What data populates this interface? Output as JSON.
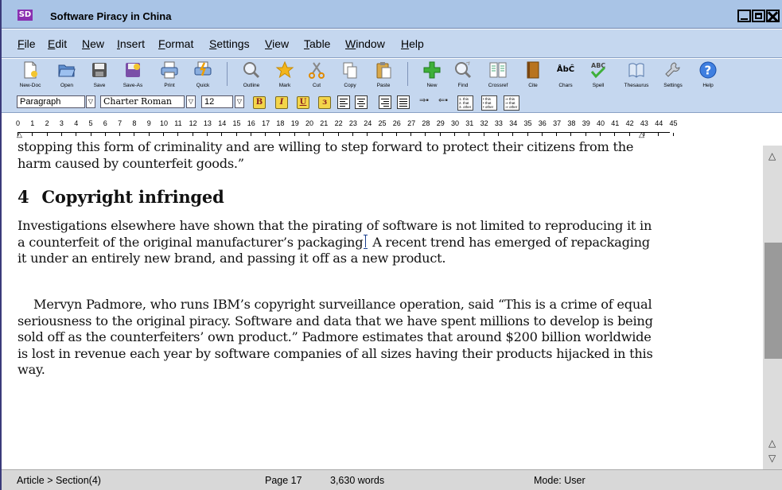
{
  "window": {
    "logo_text": "SD",
    "title": "Software Piracy in China"
  },
  "menu": {
    "items": [
      {
        "label": "File",
        "mnemonic": "F",
        "rest": "ile"
      },
      {
        "label": "Edit",
        "mnemonic": "E",
        "rest": "dit"
      },
      {
        "label": "New",
        "mnemonic": "N",
        "rest": "ew"
      },
      {
        "label": "Insert",
        "mnemonic": "I",
        "rest": "nsert"
      },
      {
        "label": "Format",
        "mnemonic": "F",
        "rest": "ormat"
      },
      {
        "label": "Settings",
        "mnemonic": "S",
        "rest": "ettings"
      },
      {
        "label": "View",
        "mnemonic": "V",
        "rest": "iew"
      },
      {
        "label": "Table",
        "mnemonic": "T",
        "rest": "able"
      },
      {
        "label": "Window",
        "mnemonic": "W",
        "rest": "indow"
      },
      {
        "label": "Help",
        "mnemonic": "H",
        "rest": "elp"
      }
    ]
  },
  "toolbar": {
    "buttons": [
      {
        "label": "New-Doc",
        "icon": "new-doc-icon"
      },
      {
        "label": "Open",
        "icon": "open-folder-icon"
      },
      {
        "label": "Save",
        "icon": "save-disk-icon"
      },
      {
        "label": "Save-As",
        "icon": "save-as-icon"
      },
      {
        "label": "Print",
        "icon": "printer-icon"
      },
      {
        "label": "Quick",
        "icon": "quick-print-icon"
      },
      {
        "label": "Outline",
        "icon": "outline-magnifier-icon"
      },
      {
        "label": "Mark",
        "icon": "star-icon"
      },
      {
        "label": "Cut",
        "icon": "scissors-icon"
      },
      {
        "label": "Copy",
        "icon": "copy-icon"
      },
      {
        "label": "Paste",
        "icon": "paste-clipboard-icon"
      },
      {
        "label": "New",
        "icon": "green-plus-icon"
      },
      {
        "label": "Find",
        "icon": "find-magnifier-icon"
      },
      {
        "label": "Crossref",
        "icon": "crossref-icon"
      },
      {
        "label": "Cite",
        "icon": "book-icon"
      },
      {
        "label": "Chars",
        "icon": "chars-icon",
        "glyph": "ÅbĈ"
      },
      {
        "label": "Spell",
        "icon": "spellcheck-icon",
        "glyph": "ABC"
      },
      {
        "label": "Thesaurus",
        "icon": "thesaurus-icon"
      },
      {
        "label": "Settings",
        "icon": "wrench-icon"
      },
      {
        "label": "Help",
        "icon": "help-icon",
        "glyph": "?"
      }
    ]
  },
  "format": {
    "style": "Paragraph",
    "font": "Charter Roman",
    "size": "12",
    "bold": "B",
    "italic": "I",
    "underline": "U",
    "list_bullets": [
      "1. this",
      "2. that",
      "3. other"
    ],
    "list_dots": [
      "• this",
      "• that",
      "• other"
    ],
    "list_indent": [
      "⇒ this",
      "⇒ that",
      "⇒ other"
    ]
  },
  "ruler": {
    "numbers": [
      "0",
      "1",
      "2",
      "3",
      "4",
      "5",
      "6",
      "7",
      "8",
      "9",
      "10",
      "11",
      "12",
      "13",
      "14",
      "15",
      "16",
      "17",
      "18",
      "19",
      "20",
      "21",
      "22",
      "23",
      "24",
      "25",
      "26",
      "27",
      "28",
      "29",
      "30",
      "31",
      "32",
      "33",
      "34",
      "35",
      "36",
      "37",
      "38",
      "39",
      "40",
      "41",
      "42",
      "43",
      "44",
      "45"
    ]
  },
  "document": {
    "para_top": "stopping this form of criminality and are willing to step forward to protect their citizens from the harm caused by counterfeit goods.”",
    "heading_number": "4",
    "heading_text": "Copyright infringed",
    "para_1_before_caret": "Investigations elsewhere have shown that the pirating of software is not limited to reproducing it in a counterfeit of the original manufacturer’s packaging",
    "para_1_after_caret": " A recent trend has emerged of repackaging it under an entirely new brand, and passing it off as a new product.",
    "para_2": "Mervyn Padmore, who runs IBM’s copyright surveillance operation, said “This is a crime of equal seriousness to the original piracy. Software and data that we have spent millions to develop is being sold off as the counterfeiters’ own product.” Padmore estimates that around $200 billion worldwide is lost in revenue each year by software companies of all sizes having their products hijacked in this way."
  },
  "status": {
    "breadcrumb": "Article > Section(4)",
    "page": "Page 17",
    "words": "3,630 words",
    "mode": "Mode: User"
  },
  "scrollbar": {
    "up_arrow": "△",
    "up_arrow_2": "△",
    "down_arrow": "▽"
  }
}
